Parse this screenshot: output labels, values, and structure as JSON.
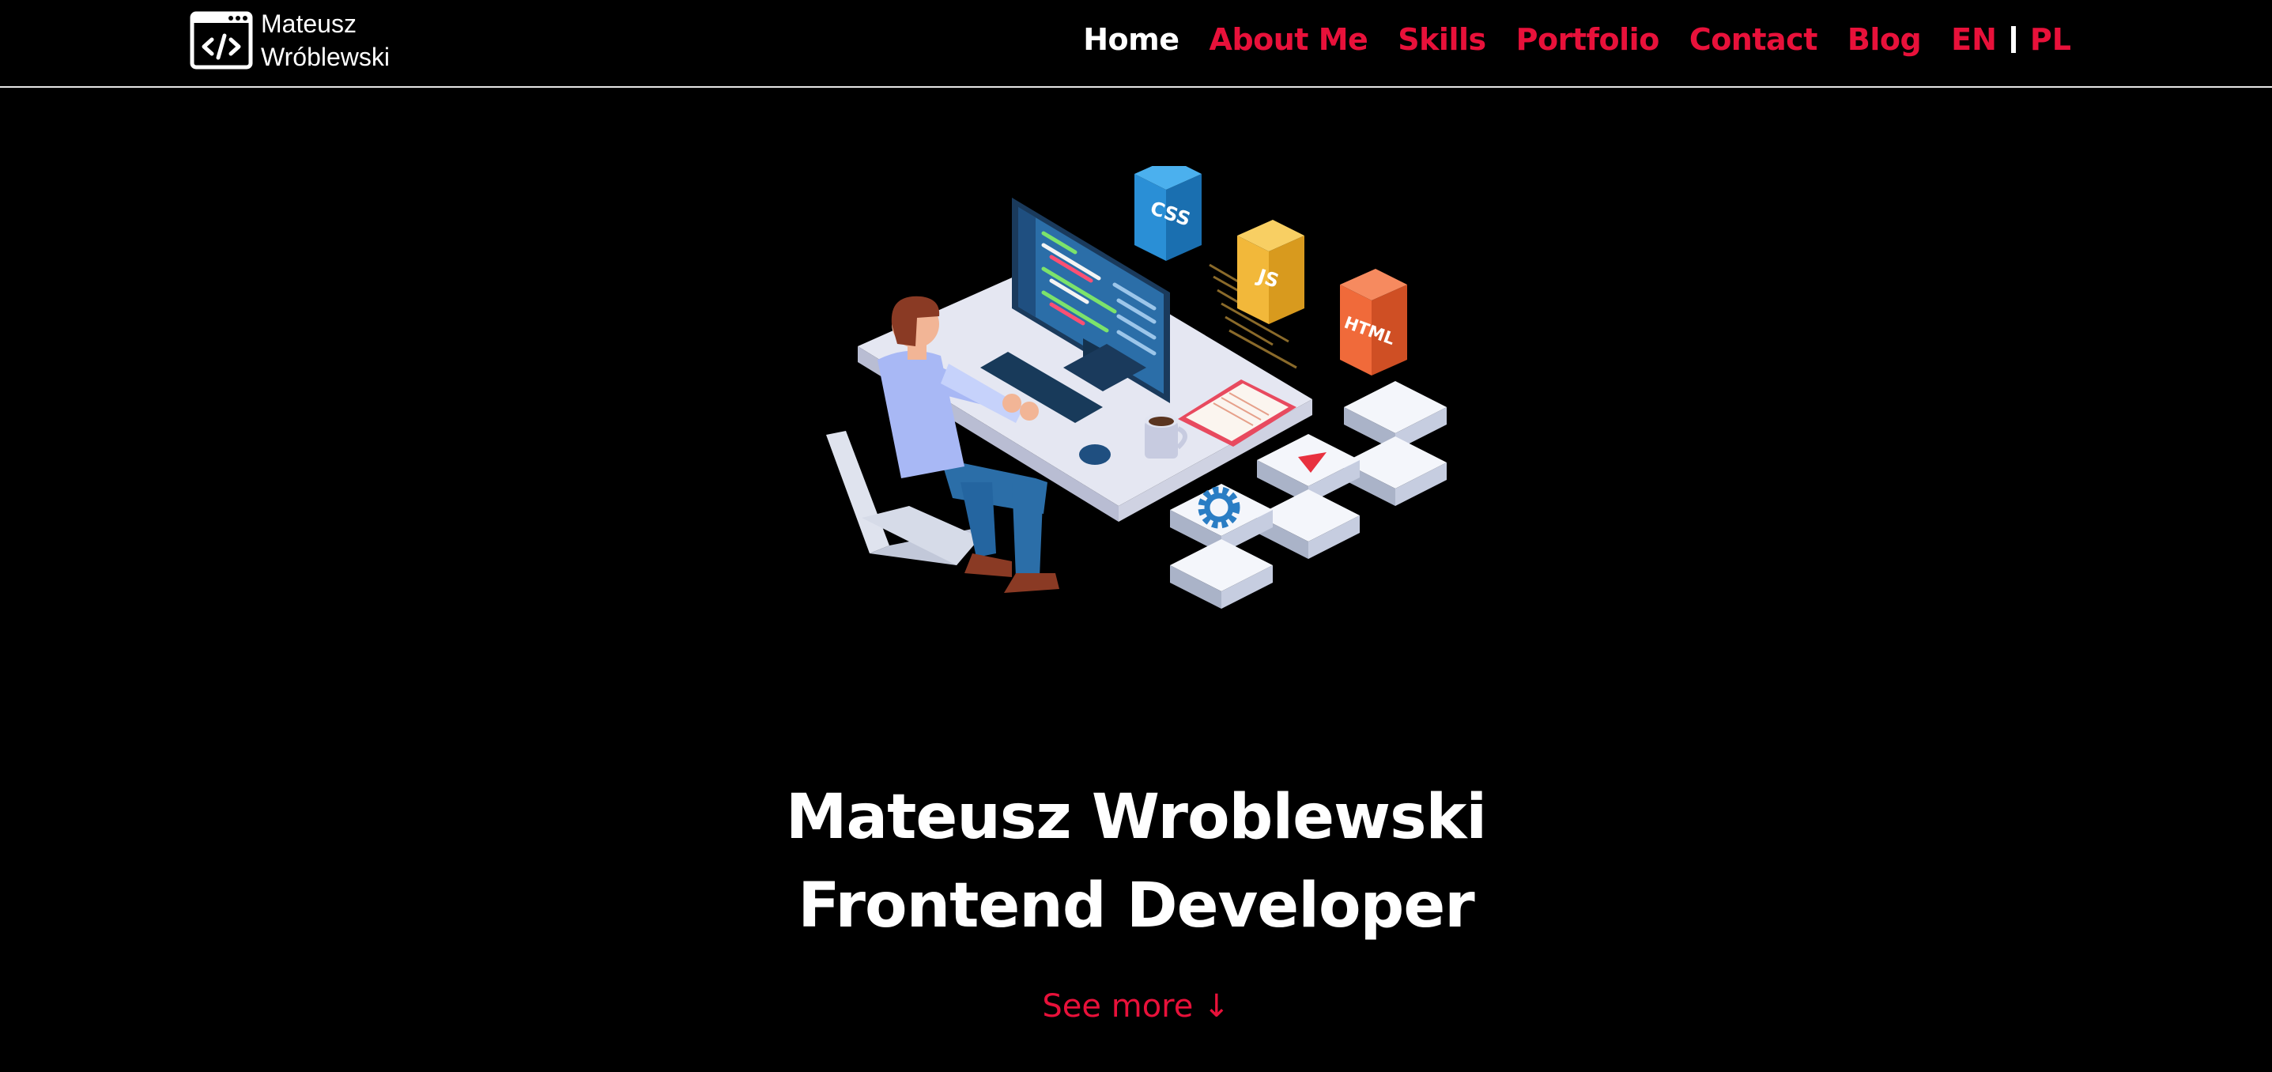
{
  "brand": {
    "first_name": "Mateusz",
    "last_name": "Wróblewski",
    "icon": "code-window-icon"
  },
  "nav": {
    "items": [
      {
        "label": "Home",
        "active": true
      },
      {
        "label": "About Me"
      },
      {
        "label": "Skills"
      },
      {
        "label": "Portfolio"
      },
      {
        "label": "Contact"
      },
      {
        "label": "Blog"
      }
    ],
    "lang_en": "EN",
    "lang_pl": "PL"
  },
  "hero": {
    "line1": "Mateusz Wroblewski",
    "line2": "Frontend Developer",
    "see_more": "See more ↓",
    "badges": {
      "css": "CSS",
      "js": "JS",
      "html": "HTML"
    }
  },
  "colors": {
    "background": "#000000",
    "accent": "#e8113a",
    "text": "#ffffff"
  }
}
